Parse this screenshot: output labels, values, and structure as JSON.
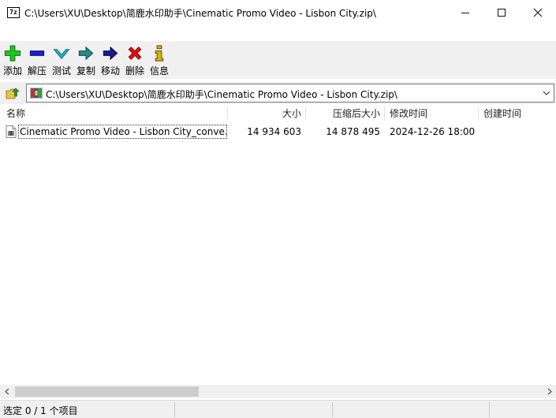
{
  "window": {
    "app_icon_text": "7z",
    "title": "C:\\Users\\XU\\Desktop\\简鹿水印助手\\Cinematic Promo Video - Lisbon City.zip\\"
  },
  "toolbar": {
    "buttons": [
      {
        "label": "添加",
        "icon": "plus-icon",
        "color": "#22c322"
      },
      {
        "label": "解压",
        "icon": "minus-icon",
        "color": "#1a1ad6"
      },
      {
        "label": "测试",
        "icon": "check-icon",
        "color": "#20b8c8"
      },
      {
        "label": "复制",
        "icon": "arrow-right-icon",
        "color": "#2a8a8a"
      },
      {
        "label": "移动",
        "icon": "arrow-right-icon",
        "color": "#1a1a8a"
      },
      {
        "label": "删除",
        "icon": "x-icon",
        "color": "#e01010"
      },
      {
        "label": "信息",
        "icon": "info-icon",
        "color": "#d8b400"
      }
    ]
  },
  "address": {
    "path": "C:\\Users\\XU\\Desktop\\简鹿水印助手\\Cinematic Promo Video - Lisbon City.zip\\"
  },
  "columns": {
    "name": "名称",
    "size": "大小",
    "packed": "压缩后大小",
    "modified": "修改时间",
    "created": "创建时间"
  },
  "files": [
    {
      "name": "Cinematic Promo Video - Lisbon City_conve...",
      "size": "14 934 603",
      "packed": "14 878 495",
      "modified": "2024-12-26 18:00",
      "created": ""
    }
  ],
  "status": {
    "selection": "选定 0 / 1 个项目"
  }
}
